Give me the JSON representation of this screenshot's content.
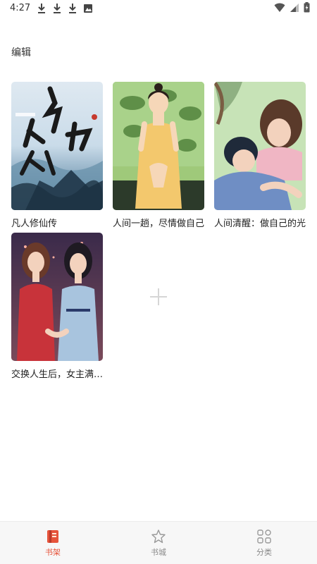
{
  "status_bar": {
    "time": "4:27",
    "left_icons": [
      "download-icon",
      "download-icon",
      "download-icon",
      "image-icon"
    ],
    "right_icons": [
      "wifi-icon",
      "signal-icon",
      "battery-icon"
    ]
  },
  "header": {
    "edit_label": "编辑"
  },
  "bookshelf": {
    "books": [
      {
        "title": "凡人修仙传",
        "cover_icon": "book-cover-fantasy"
      },
      {
        "title": "人间一趟，尽情做自己",
        "cover_icon": "book-cover-girl"
      },
      {
        "title": "人间清醒：做自己的光",
        "cover_icon": "book-cover-couple"
      },
      {
        "title": "交换人生后，女主满级归来",
        "cover_icon": "book-cover-two-women"
      }
    ],
    "add_icon": "plus-icon"
  },
  "bottom_nav": {
    "items": [
      {
        "label": "书架",
        "icon": "bookshelf-icon",
        "active": true
      },
      {
        "label": "书城",
        "icon": "bookstore-icon",
        "active": false
      },
      {
        "label": "分类",
        "icon": "category-icon",
        "active": false
      }
    ]
  },
  "colors": {
    "accent": "#e6533a",
    "nav_bg": "#f7f7f7"
  }
}
